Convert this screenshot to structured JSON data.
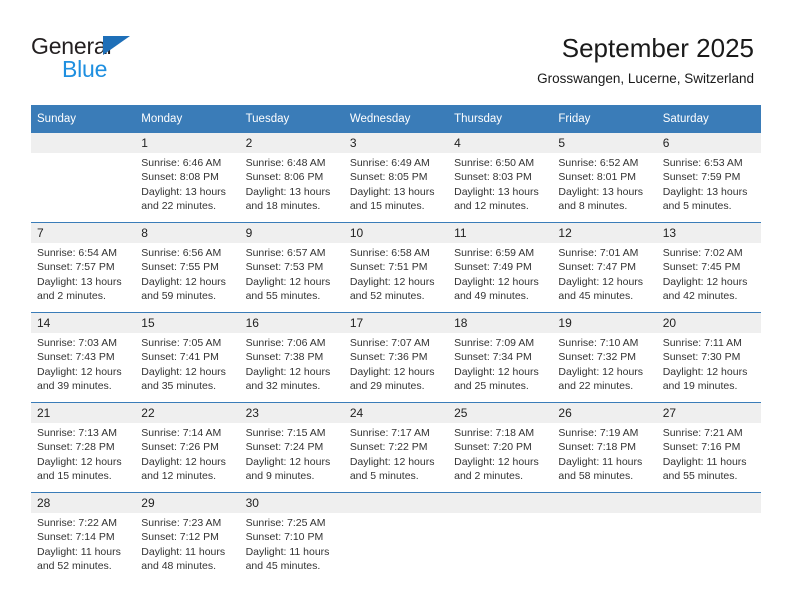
{
  "brand": {
    "name_part1": "General",
    "name_part2": "Blue",
    "triangle_icon": "triangle-icon",
    "colors": {
      "dark": "#231f20",
      "blue": "#1e8fe0",
      "triangle": "#1e6fb8"
    }
  },
  "header": {
    "title": "September 2025",
    "subtitle": "Grosswangen, Lucerne, Switzerland"
  },
  "theme": {
    "header_row_bg": "#3a7cb8",
    "header_row_text": "#ffffff",
    "daynum_bg": "#efefef",
    "row_divider": "#3a7cb8",
    "body_text": "#333333"
  },
  "calendar": {
    "month": "September",
    "year": "2025",
    "weekday_headers": [
      "Sunday",
      "Monday",
      "Tuesday",
      "Wednesday",
      "Thursday",
      "Friday",
      "Saturday"
    ],
    "weeks": [
      [
        {
          "day": "",
          "lines": []
        },
        {
          "day": "1",
          "lines": [
            "Sunrise: 6:46 AM",
            "Sunset: 8:08 PM",
            "Daylight: 13 hours",
            "and 22 minutes."
          ]
        },
        {
          "day": "2",
          "lines": [
            "Sunrise: 6:48 AM",
            "Sunset: 8:06 PM",
            "Daylight: 13 hours",
            "and 18 minutes."
          ]
        },
        {
          "day": "3",
          "lines": [
            "Sunrise: 6:49 AM",
            "Sunset: 8:05 PM",
            "Daylight: 13 hours",
            "and 15 minutes."
          ]
        },
        {
          "day": "4",
          "lines": [
            "Sunrise: 6:50 AM",
            "Sunset: 8:03 PM",
            "Daylight: 13 hours",
            "and 12 minutes."
          ]
        },
        {
          "day": "5",
          "lines": [
            "Sunrise: 6:52 AM",
            "Sunset: 8:01 PM",
            "Daylight: 13 hours",
            "and 8 minutes."
          ]
        },
        {
          "day": "6",
          "lines": [
            "Sunrise: 6:53 AM",
            "Sunset: 7:59 PM",
            "Daylight: 13 hours",
            "and 5 minutes."
          ]
        }
      ],
      [
        {
          "day": "7",
          "lines": [
            "Sunrise: 6:54 AM",
            "Sunset: 7:57 PM",
            "Daylight: 13 hours",
            "and 2 minutes."
          ]
        },
        {
          "day": "8",
          "lines": [
            "Sunrise: 6:56 AM",
            "Sunset: 7:55 PM",
            "Daylight: 12 hours",
            "and 59 minutes."
          ]
        },
        {
          "day": "9",
          "lines": [
            "Sunrise: 6:57 AM",
            "Sunset: 7:53 PM",
            "Daylight: 12 hours",
            "and 55 minutes."
          ]
        },
        {
          "day": "10",
          "lines": [
            "Sunrise: 6:58 AM",
            "Sunset: 7:51 PM",
            "Daylight: 12 hours",
            "and 52 minutes."
          ]
        },
        {
          "day": "11",
          "lines": [
            "Sunrise: 6:59 AM",
            "Sunset: 7:49 PM",
            "Daylight: 12 hours",
            "and 49 minutes."
          ]
        },
        {
          "day": "12",
          "lines": [
            "Sunrise: 7:01 AM",
            "Sunset: 7:47 PM",
            "Daylight: 12 hours",
            "and 45 minutes."
          ]
        },
        {
          "day": "13",
          "lines": [
            "Sunrise: 7:02 AM",
            "Sunset: 7:45 PM",
            "Daylight: 12 hours",
            "and 42 minutes."
          ]
        }
      ],
      [
        {
          "day": "14",
          "lines": [
            "Sunrise: 7:03 AM",
            "Sunset: 7:43 PM",
            "Daylight: 12 hours",
            "and 39 minutes."
          ]
        },
        {
          "day": "15",
          "lines": [
            "Sunrise: 7:05 AM",
            "Sunset: 7:41 PM",
            "Daylight: 12 hours",
            "and 35 minutes."
          ]
        },
        {
          "day": "16",
          "lines": [
            "Sunrise: 7:06 AM",
            "Sunset: 7:38 PM",
            "Daylight: 12 hours",
            "and 32 minutes."
          ]
        },
        {
          "day": "17",
          "lines": [
            "Sunrise: 7:07 AM",
            "Sunset: 7:36 PM",
            "Daylight: 12 hours",
            "and 29 minutes."
          ]
        },
        {
          "day": "18",
          "lines": [
            "Sunrise: 7:09 AM",
            "Sunset: 7:34 PM",
            "Daylight: 12 hours",
            "and 25 minutes."
          ]
        },
        {
          "day": "19",
          "lines": [
            "Sunrise: 7:10 AM",
            "Sunset: 7:32 PM",
            "Daylight: 12 hours",
            "and 22 minutes."
          ]
        },
        {
          "day": "20",
          "lines": [
            "Sunrise: 7:11 AM",
            "Sunset: 7:30 PM",
            "Daylight: 12 hours",
            "and 19 minutes."
          ]
        }
      ],
      [
        {
          "day": "21",
          "lines": [
            "Sunrise: 7:13 AM",
            "Sunset: 7:28 PM",
            "Daylight: 12 hours",
            "and 15 minutes."
          ]
        },
        {
          "day": "22",
          "lines": [
            "Sunrise: 7:14 AM",
            "Sunset: 7:26 PM",
            "Daylight: 12 hours",
            "and 12 minutes."
          ]
        },
        {
          "day": "23",
          "lines": [
            "Sunrise: 7:15 AM",
            "Sunset: 7:24 PM",
            "Daylight: 12 hours",
            "and 9 minutes."
          ]
        },
        {
          "day": "24",
          "lines": [
            "Sunrise: 7:17 AM",
            "Sunset: 7:22 PM",
            "Daylight: 12 hours",
            "and 5 minutes."
          ]
        },
        {
          "day": "25",
          "lines": [
            "Sunrise: 7:18 AM",
            "Sunset: 7:20 PM",
            "Daylight: 12 hours",
            "and 2 minutes."
          ]
        },
        {
          "day": "26",
          "lines": [
            "Sunrise: 7:19 AM",
            "Sunset: 7:18 PM",
            "Daylight: 11 hours",
            "and 58 minutes."
          ]
        },
        {
          "day": "27",
          "lines": [
            "Sunrise: 7:21 AM",
            "Sunset: 7:16 PM",
            "Daylight: 11 hours",
            "and 55 minutes."
          ]
        }
      ],
      [
        {
          "day": "28",
          "lines": [
            "Sunrise: 7:22 AM",
            "Sunset: 7:14 PM",
            "Daylight: 11 hours",
            "and 52 minutes."
          ]
        },
        {
          "day": "29",
          "lines": [
            "Sunrise: 7:23 AM",
            "Sunset: 7:12 PM",
            "Daylight: 11 hours",
            "and 48 minutes."
          ]
        },
        {
          "day": "30",
          "lines": [
            "Sunrise: 7:25 AM",
            "Sunset: 7:10 PM",
            "Daylight: 11 hours",
            "and 45 minutes."
          ]
        },
        {
          "day": "",
          "lines": []
        },
        {
          "day": "",
          "lines": []
        },
        {
          "day": "",
          "lines": []
        },
        {
          "day": "",
          "lines": []
        }
      ]
    ]
  }
}
